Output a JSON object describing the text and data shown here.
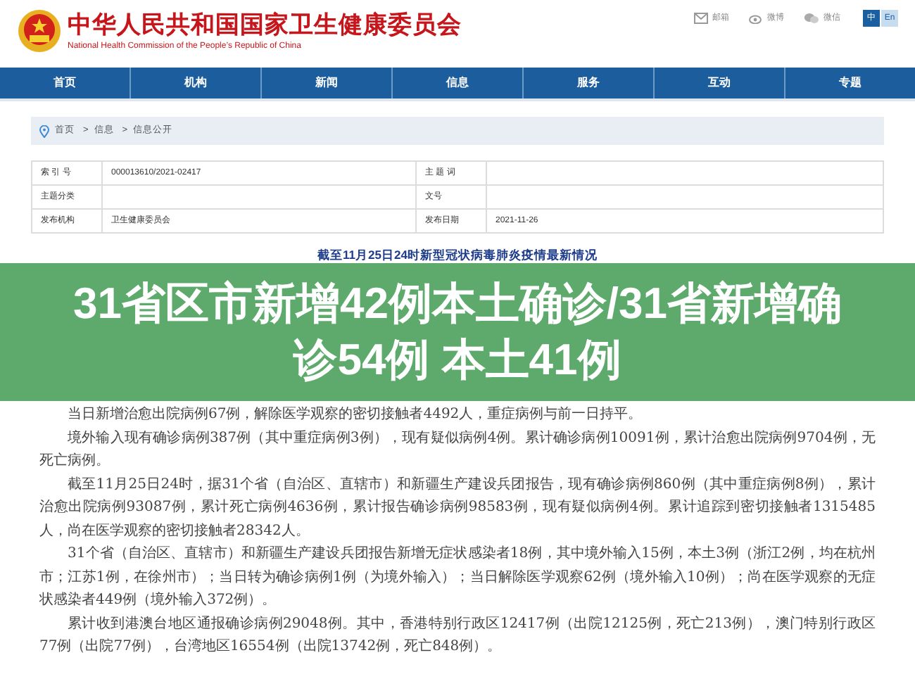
{
  "header": {
    "title": "中华人民共和国国家卫生健康委员会",
    "subtitle": "National Health Commission of the People’s Republic of China",
    "links": [
      {
        "kind": "mail",
        "label": "邮箱"
      },
      {
        "kind": "weibo",
        "label": "微博"
      },
      {
        "kind": "wechat",
        "label": "微信"
      }
    ],
    "languages": [
      {
        "label": "中",
        "selected": true
      },
      {
        "label": "En",
        "selected": false
      }
    ]
  },
  "nav": [
    "首页",
    "机构",
    "新闻",
    "信息",
    "服务",
    "互动",
    "专题"
  ],
  "breadcrumb": [
    "首页",
    "信息",
    "信息公开"
  ],
  "breadcrumb_separator": ">",
  "meta_table": [
    [
      {
        "label": "索 引 号",
        "value": "000013610/2021-02417"
      },
      {
        "label": "主 题 词"
      }
    ],
    [
      {
        "label": "主题分类"
      },
      {
        "label": "文号"
      }
    ],
    [
      {
        "label": "发布机构",
        "value": "卫生健康委员会"
      },
      {
        "label": "发布日期",
        "value": "2021-11-26"
      }
    ]
  ],
  "article_title": "截至11月25日24时新型冠状病毒肺炎疫情最新情况",
  "overlay_headline": "31省区市新增42例本土确诊/31省新增确诊54例 本土41例",
  "paragraphs": [
    "当日新增治愈出院病例67例，解除医学观察的密切接触者4492人，重症病例与前一日持平。",
    "境外输入现有确诊病例387例（其中重症病例3例），现有疑似病例4例。累计确诊病例10091例，累计治愈出院病例9704例，无死亡病例。",
    "截至11月25日24时，据31个省（自治区、直辖市）和新疆生产建设兵团报告，现有确诊病例860例（其中重症病例8例），累计治愈出院病例93087例，累计死亡病例4636例，累计报告确诊病例98583例，现有疑似病例4例。累计追踪到密切接触者1315485人，尚在医学观察的密切接触者28342人。",
    "31个省（自治区、直辖市）和新疆生产建设兵团报告新增无症状感染者18例，其中境外输入15例，本土3例（浙江2例，均在杭州市；江苏1例，在徐州市）；当日转为确诊病例1例（为境外输入）；当日解除医学观察62例（境外输入10例）；尚在医学观察的无症状感染者449例（境外输入372例）。",
    "累计收到港澳台地区通报确诊病例29048例。其中，香港特别行政区12417例（出院12125例，死亡213例），澳门特别行政区77例（出院77例），台湾地区16554例（出院13742例，死亡848例）。"
  ]
}
